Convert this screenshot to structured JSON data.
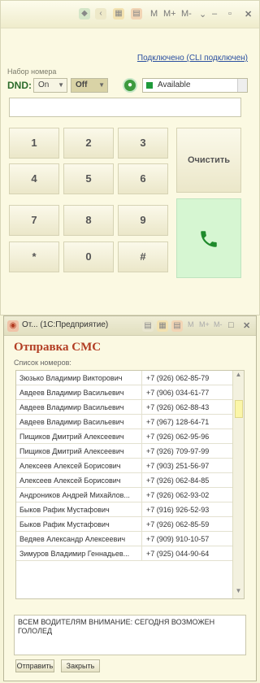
{
  "top_window": {
    "toolbar": [
      "M",
      "M+",
      "M-"
    ],
    "dial_label": "Набор номера",
    "connection_status": "Подключено (CLI подключен)",
    "dnd_label": "DND:",
    "dnd_on": "On",
    "dnd_off": "Off",
    "presence": "Available",
    "number_value": "",
    "keys": [
      "1",
      "2",
      "3",
      "4",
      "5",
      "6",
      "7",
      "8",
      "9",
      "*",
      "0",
      "#"
    ],
    "clear_label": "Очистить"
  },
  "sms_window": {
    "window_title": "От... (1С:Предприятие)",
    "title": "Отправка СМС",
    "list_label": "Список номеров:",
    "contacts": [
      {
        "name": "Зюзько Владимир Викторович",
        "phone": "+7 (926) 062-85-79"
      },
      {
        "name": "Авдеев Владимир Васильевич",
        "phone": "+7 (906) 034-61-77"
      },
      {
        "name": "Авдеев Владимир Васильевич",
        "phone": "+7 (926) 062-88-43"
      },
      {
        "name": "Авдеев Владимир Васильевич",
        "phone": "+7 (967) 128-64-71"
      },
      {
        "name": "Пищиков Дмитрий Алексеевич",
        "phone": "+7 (926) 062-95-96"
      },
      {
        "name": "Пищиков Дмитрий Алексеевич",
        "phone": "+7 (926) 709-97-99"
      },
      {
        "name": "Алексеев Алексей Борисович",
        "phone": "+7 (903) 251-56-97"
      },
      {
        "name": "Алексеев Алексей Борисович",
        "phone": "+7 (926) 062-84-85"
      },
      {
        "name": "Андроников Андрей Михайлов...",
        "phone": "+7 (926) 062-93-02"
      },
      {
        "name": "Быков Рафик Мустафович",
        "phone": "+7 (916) 926-52-93"
      },
      {
        "name": "Быков Рафик Мустафович",
        "phone": "+7 (926) 062-85-59"
      },
      {
        "name": "Ведяев Александр Алексеевич",
        "phone": "+7 (909) 910-10-57"
      },
      {
        "name": "Зимуров Владимир Геннадьев...",
        "phone": "+7 (925) 044-90-64"
      }
    ],
    "message": "Всем водителям ВНИМАНИЕ: СЕГОДНЯ ВОЗМОЖЕН ГОЛОЛЕД",
    "send_label": "Отправить",
    "close_label": "Закрыть"
  },
  "colors": {
    "accent_title": "#b23d23",
    "presence_green": "#1f9a3a",
    "call_button": "#d6f6d2"
  }
}
